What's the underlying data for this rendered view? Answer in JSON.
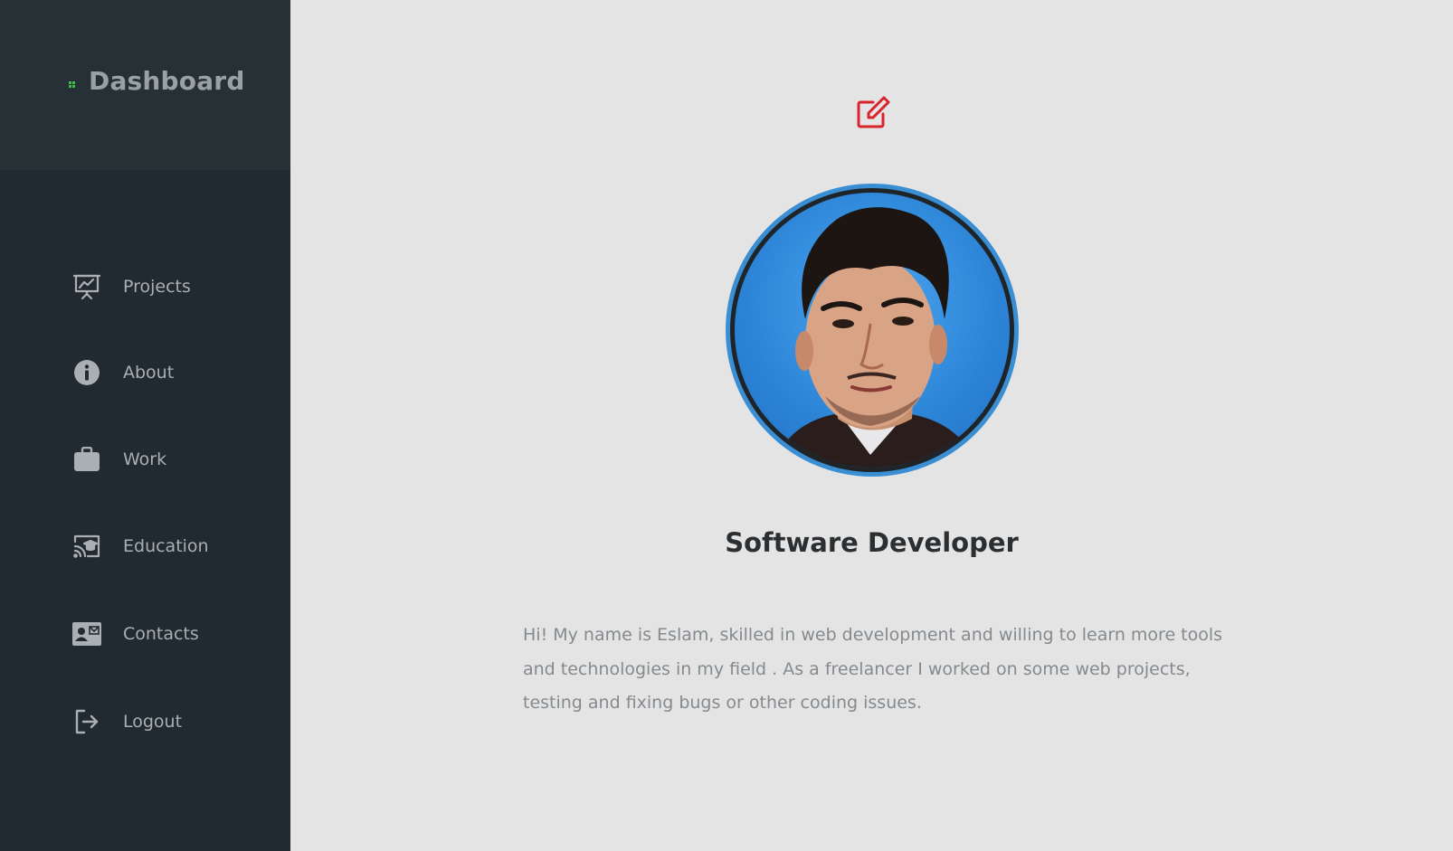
{
  "sidebar": {
    "brand": {
      "title": "Dashboard",
      "icon": "grid-dot-icon",
      "accent_color": "#3fbf4a"
    },
    "items": [
      {
        "label": "Projects",
        "icon": "presentation-chart-icon"
      },
      {
        "label": "About",
        "icon": "info-circle-icon"
      },
      {
        "label": "Work",
        "icon": "briefcase-icon"
      },
      {
        "label": "Education",
        "icon": "cast-education-icon"
      },
      {
        "label": "Contacts",
        "icon": "contact-card-icon"
      },
      {
        "label": "Logout",
        "icon": "logout-icon"
      }
    ],
    "background_color": "#212a30"
  },
  "main": {
    "edit_icon": "edit-icon",
    "edit_color": "#d9232d",
    "avatar": {
      "ring_color": "#3a8fd4",
      "alt": "profile-photo"
    },
    "role": "Software Developer",
    "bio": "Hi! My name is Eslam, skilled in web development and willing to learn more tools and technologies in my field . As a freelancer I worked on some web projects, testing and fixing bugs or other coding issues."
  }
}
